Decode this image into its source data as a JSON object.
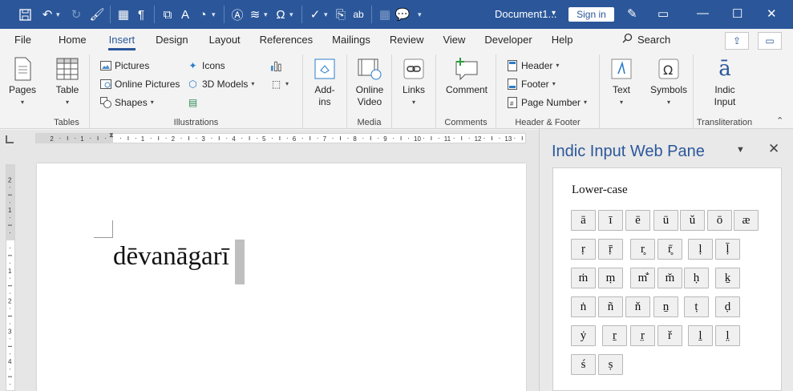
{
  "titlebar": {
    "document_title": "Document1...",
    "signin_label": "Sign in",
    "qat_icons": [
      "save-icon",
      "undo-icon",
      "redo-icon",
      "format-painter-icon",
      "table-icon",
      "pilcrow-icon",
      "screenshot-icon",
      "text-effects-icon",
      "shapes-icon",
      "textbox-icon",
      "equation-icon",
      "symbol-icon",
      "check-icon",
      "copy-icon",
      "ab-icon",
      "table2-icon",
      "comment-icon"
    ],
    "window_icons": [
      "pen-icon",
      "ribbon-display-icon",
      "minimize-icon",
      "restore-icon",
      "close-icon"
    ]
  },
  "tabs": [
    "File",
    "Home",
    "Insert",
    "Design",
    "Layout",
    "References",
    "Mailings",
    "Review",
    "View",
    "Developer",
    "Help"
  ],
  "active_tab": "Insert",
  "search_label": "Search",
  "ribbon": {
    "pages": {
      "label": "Pages"
    },
    "tables": {
      "button": "Table",
      "group": "Tables"
    },
    "illustrations": {
      "pictures": "Pictures",
      "online_pictures": "Online Pictures",
      "shapes": "Shapes",
      "icons": "Icons",
      "models": "3D Models",
      "group": "Illustrations"
    },
    "addins": {
      "line1": "Add-",
      "line2": "ins"
    },
    "media": {
      "line1": "Online",
      "line2": "Video",
      "group": "Media"
    },
    "links": {
      "label": "Links"
    },
    "comments": {
      "label": "Comment",
      "group": "Comments"
    },
    "header_footer": {
      "header": "Header",
      "footer": "Footer",
      "page_number": "Page Number",
      "group": "Header & Footer"
    },
    "text": {
      "label": "Text"
    },
    "symbols": {
      "label": "Symbols"
    },
    "transliteration": {
      "line1": "Indic",
      "line2": "Input",
      "group": "Transliteration"
    }
  },
  "ruler": {
    "ticks": [
      "2",
      "1",
      "1",
      "2",
      "3",
      "4",
      "5",
      "6",
      "7",
      "8",
      "9",
      "10",
      "11",
      "12",
      "13"
    ]
  },
  "vruler": {
    "ticks": [
      "2",
      "1",
      "1",
      "2",
      "3",
      "4"
    ]
  },
  "document": {
    "text": "dēvanāgarī"
  },
  "pane": {
    "title": "Indic Input Web Pane",
    "section_label": "Lower-case",
    "rows": [
      [
        "ā",
        "ī",
        "ē",
        "ū",
        "ǔ",
        "ō",
        "æ"
      ],
      [
        "ṛ",
        "ṝ",
        "r̥",
        "r̥̄",
        "ḷ",
        "ḹ"
      ],
      [
        "ṁ",
        "ṃ",
        "m̐",
        "m̆",
        "ḥ",
        "ḵ"
      ],
      [
        "ṅ",
        "ñ",
        "ň",
        "ṉ",
        "ṭ",
        "ḍ"
      ],
      [
        "ẏ",
        "ṟ",
        "r̤",
        "ř",
        "ḻ",
        "l̤"
      ],
      [
        "ś",
        "ṣ"
      ]
    ]
  },
  "colors": {
    "accent": "#2b579a",
    "ribbon_bg": "#f3f3f3",
    "pane_bg": "#e9e9e9"
  }
}
